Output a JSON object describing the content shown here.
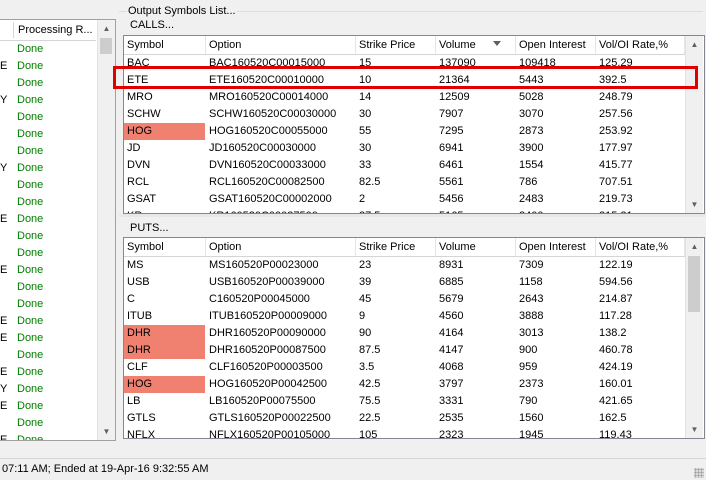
{
  "left_panel": {
    "header": "Processing R...",
    "rows": [
      {
        "c1": "",
        "c2": "Done"
      },
      {
        "c1": "E",
        "c2": "Done"
      },
      {
        "c1": "",
        "c2": "Done"
      },
      {
        "c1": "Y",
        "c2": "Done"
      },
      {
        "c1": "",
        "c2": "Done"
      },
      {
        "c1": "",
        "c2": "Done"
      },
      {
        "c1": "",
        "c2": "Done"
      },
      {
        "c1": "Y",
        "c2": "Done"
      },
      {
        "c1": "",
        "c2": "Done"
      },
      {
        "c1": "",
        "c2": "Done"
      },
      {
        "c1": "E",
        "c2": "Done"
      },
      {
        "c1": "",
        "c2": "Done"
      },
      {
        "c1": "",
        "c2": "Done"
      },
      {
        "c1": "E",
        "c2": "Done"
      },
      {
        "c1": "",
        "c2": "Done"
      },
      {
        "c1": "",
        "c2": "Done"
      },
      {
        "c1": "E",
        "c2": "Done"
      },
      {
        "c1": "E",
        "c2": "Done"
      },
      {
        "c1": "",
        "c2": "Done"
      },
      {
        "c1": "E",
        "c2": "Done"
      },
      {
        "c1": "Y",
        "c2": "Done"
      },
      {
        "c1": "E",
        "c2": "Done"
      },
      {
        "c1": "",
        "c2": "Done"
      },
      {
        "c1": "E",
        "c2": "Done"
      }
    ]
  },
  "group_title": "Output Symbols List...",
  "calls": {
    "label": "CALLS...",
    "columns": [
      "Symbol",
      "Option",
      "Strike Price",
      "Volume",
      "Open Interest",
      "Vol/OI Rate,%"
    ],
    "rows": [
      {
        "symbol": "BAC",
        "option": "BAC160520C00015000",
        "strike": "15",
        "volume": "137090",
        "oi": "109418",
        "rate": "125.29",
        "red": false
      },
      {
        "symbol": "ETE",
        "option": "ETE160520C00010000",
        "strike": "10",
        "volume": "21364",
        "oi": "5443",
        "rate": "392.5",
        "red": false
      },
      {
        "symbol": "MRO",
        "option": "MRO160520C00014000",
        "strike": "14",
        "volume": "12509",
        "oi": "5028",
        "rate": "248.79",
        "red": false
      },
      {
        "symbol": "SCHW",
        "option": "SCHW160520C00030000",
        "strike": "30",
        "volume": "7907",
        "oi": "3070",
        "rate": "257.56",
        "red": false
      },
      {
        "symbol": "HOG",
        "option": "HOG160520C00055000",
        "strike": "55",
        "volume": "7295",
        "oi": "2873",
        "rate": "253.92",
        "red": true
      },
      {
        "symbol": "JD",
        "option": "JD160520C00030000",
        "strike": "30",
        "volume": "6941",
        "oi": "3900",
        "rate": "177.97",
        "red": false
      },
      {
        "symbol": "DVN",
        "option": "DVN160520C00033000",
        "strike": "33",
        "volume": "6461",
        "oi": "1554",
        "rate": "415.77",
        "red": false
      },
      {
        "symbol": "RCL",
        "option": "RCL160520C00082500",
        "strike": "82.5",
        "volume": "5561",
        "oi": "786",
        "rate": "707.51",
        "red": false
      },
      {
        "symbol": "GSAT",
        "option": "GSAT160520C00002000",
        "strike": "2",
        "volume": "5456",
        "oi": "2483",
        "rate": "219.73",
        "red": false
      },
      {
        "symbol": "KR",
        "option": "KR160520C00037500",
        "strike": "37.5",
        "volume": "5165",
        "oi": "2400",
        "rate": "215.21",
        "red": false
      }
    ]
  },
  "puts": {
    "label": "PUTS...",
    "columns": [
      "Symbol",
      "Option",
      "Strike Price",
      "Volume",
      "Open Interest",
      "Vol/OI Rate,%"
    ],
    "rows": [
      {
        "symbol": "MS",
        "option": "MS160520P00023000",
        "strike": "23",
        "volume": "8931",
        "oi": "7309",
        "rate": "122.19",
        "red": false
      },
      {
        "symbol": "USB",
        "option": "USB160520P00039000",
        "strike": "39",
        "volume": "6885",
        "oi": "1158",
        "rate": "594.56",
        "red": false
      },
      {
        "symbol": "C",
        "option": "C160520P00045000",
        "strike": "45",
        "volume": "5679",
        "oi": "2643",
        "rate": "214.87",
        "red": false
      },
      {
        "symbol": "ITUB",
        "option": "ITUB160520P00009000",
        "strike": "9",
        "volume": "4560",
        "oi": "3888",
        "rate": "117.28",
        "red": false
      },
      {
        "symbol": "DHR",
        "option": "DHR160520P00090000",
        "strike": "90",
        "volume": "4164",
        "oi": "3013",
        "rate": "138.2",
        "red": true
      },
      {
        "symbol": "DHR",
        "option": "DHR160520P00087500",
        "strike": "87.5",
        "volume": "4147",
        "oi": "900",
        "rate": "460.78",
        "red": true
      },
      {
        "symbol": "CLF",
        "option": "CLF160520P00003500",
        "strike": "3.5",
        "volume": "4068",
        "oi": "959",
        "rate": "424.19",
        "red": false
      },
      {
        "symbol": "HOG",
        "option": "HOG160520P00042500",
        "strike": "42.5",
        "volume": "3797",
        "oi": "2373",
        "rate": "160.01",
        "red": true
      },
      {
        "symbol": "LB",
        "option": "LB160520P00075500",
        "strike": "75.5",
        "volume": "3331",
        "oi": "790",
        "rate": "421.65",
        "red": false
      },
      {
        "symbol": "GTLS",
        "option": "GTLS160520P00022500",
        "strike": "22.5",
        "volume": "2535",
        "oi": "1560",
        "rate": "162.5",
        "red": false
      },
      {
        "symbol": "NFLX",
        "option": "NFLX160520P00105000",
        "strike": "105",
        "volume": "2323",
        "oi": "1945",
        "rate": "119.43",
        "red": false
      }
    ]
  },
  "status": {
    "text": "07:11 AM; Ended at 19-Apr-16 9:32:55 AM"
  },
  "colors": {
    "highlight_cell": "#f08070",
    "done_text": "#008000",
    "annotation_box": "#e00000"
  }
}
